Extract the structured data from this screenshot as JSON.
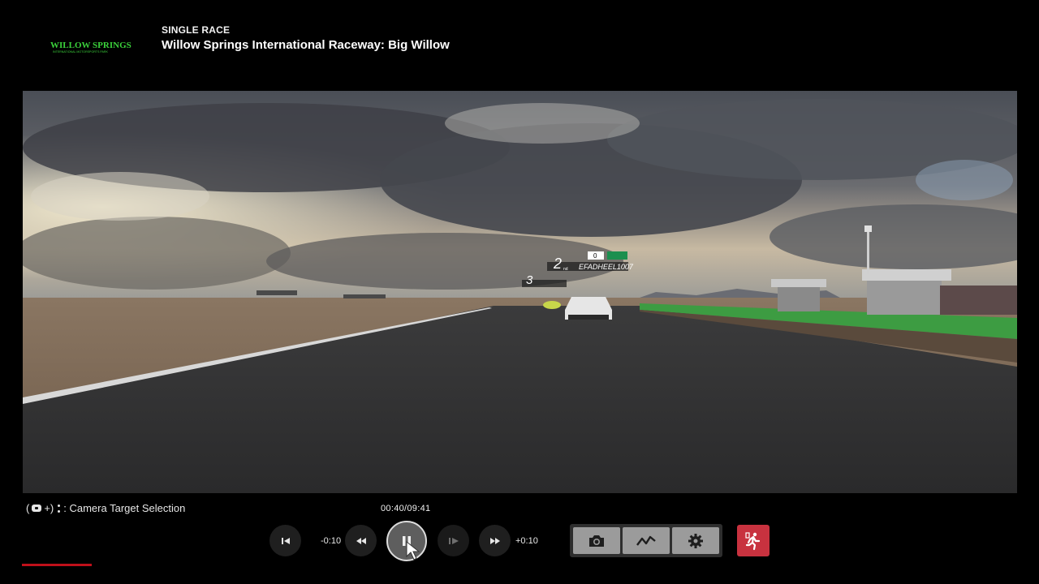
{
  "header": {
    "logo_text": "WILLOW SPRINGS",
    "logo_subtext": "INTERNATIONAL MOTORSPORTS PARK",
    "race_mode": "SINGLE RACE",
    "track_title": "Willow Springs International Raceway: Big Willow"
  },
  "viewport": {
    "hud": {
      "leader_label": "EFADHEEL1007",
      "leader_position": "2",
      "leader_suffix": "nd",
      "leader_badge": "0",
      "third_position": "3"
    }
  },
  "controls": {
    "camera_hint_text": ": Camera Target Selection",
    "time_readout": "00:40/09:41",
    "rewind_label": "-0:10",
    "forward_label": "+0:10"
  },
  "icons": {
    "prev": "skip-previous-icon",
    "rewind": "rewind-icon",
    "pause": "pause-icon",
    "frame": "frame-advance-icon",
    "forward": "fast-forward-icon",
    "camera": "camera-icon",
    "telemetry": "telemetry-graph-icon",
    "settings": "gear-icon",
    "exit": "exit-run-icon"
  },
  "colors": {
    "accent_red": "#c8323f",
    "logo_green": "#3bd13b"
  }
}
